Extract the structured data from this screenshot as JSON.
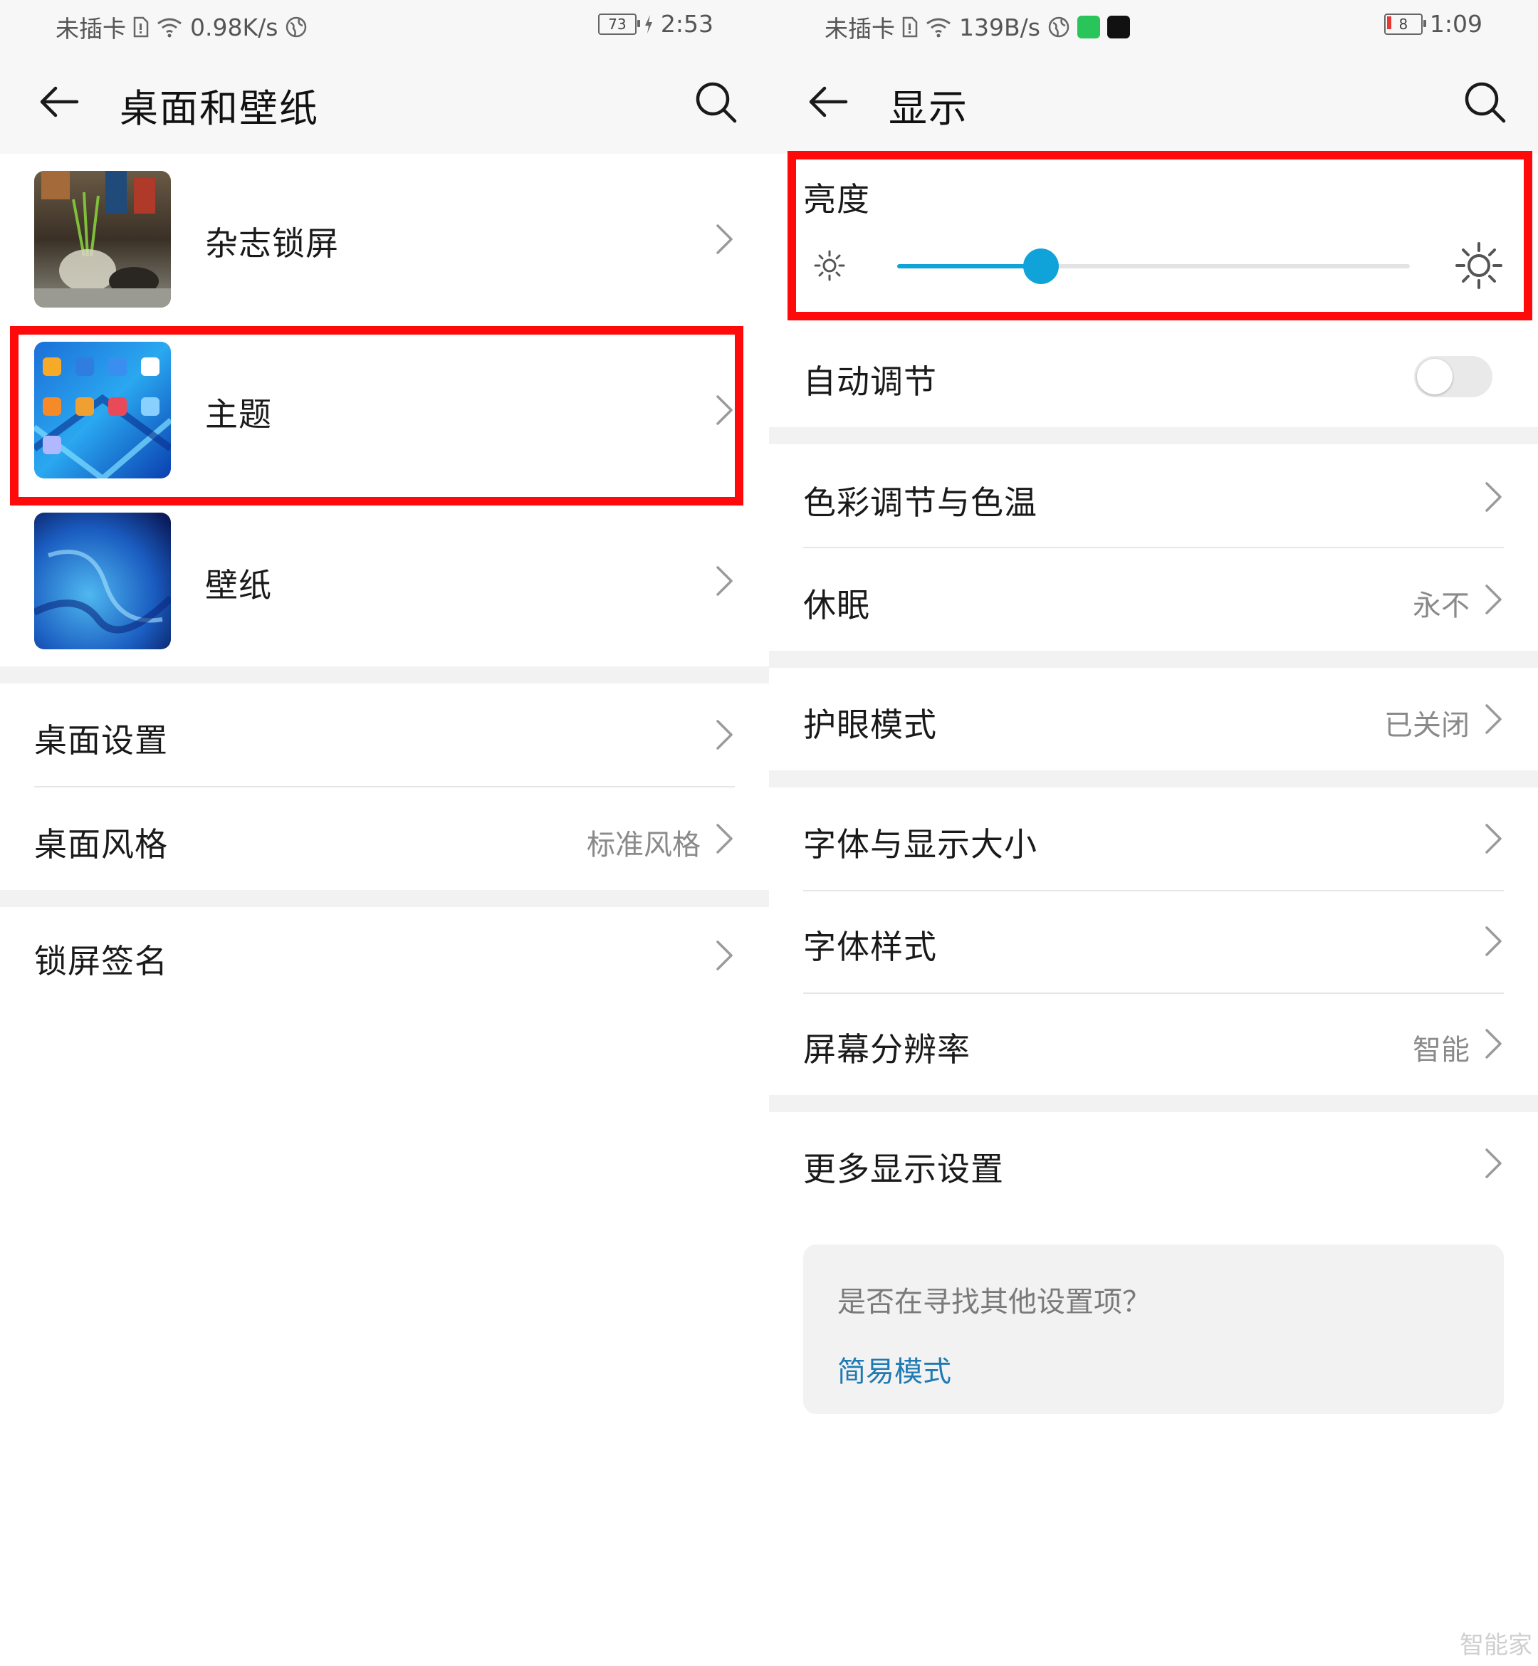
{
  "left": {
    "status": {
      "carrier": "未插卡",
      "speed": "0.98K/s",
      "battery": "73",
      "time": "2:53"
    },
    "title": "桌面和壁纸",
    "items": [
      {
        "label": "杂志锁屏"
      },
      {
        "label": "主题"
      },
      {
        "label": "壁纸"
      },
      {
        "label": "桌面设置"
      },
      {
        "label": "桌面风格",
        "value": "标准风格"
      },
      {
        "label": "锁屏签名"
      }
    ]
  },
  "right": {
    "status": {
      "carrier": "未插卡",
      "speed": "139B/s",
      "battery": "8",
      "time": "1:09"
    },
    "title": "显示",
    "brightness": {
      "label": "亮度",
      "level": 0.28
    },
    "auto_adjust": {
      "label": "自动调节",
      "on": false
    },
    "items": [
      {
        "label": "色彩调节与色温"
      },
      {
        "label": "休眠",
        "value": "永不"
      },
      {
        "label": "护眼模式",
        "value": "已关闭"
      },
      {
        "label": "字体与显示大小"
      },
      {
        "label": "字体样式"
      },
      {
        "label": "屏幕分辨率",
        "value": "智能"
      },
      {
        "label": "更多显示设置"
      }
    ],
    "hint": {
      "question": "是否在寻找其他设置项？",
      "link": "简易模式"
    }
  },
  "colors": {
    "highlight_box": "#ff0a0a",
    "accent": "#0fa3d9",
    "link": "#1f7ab3"
  },
  "watermark": "智能家"
}
